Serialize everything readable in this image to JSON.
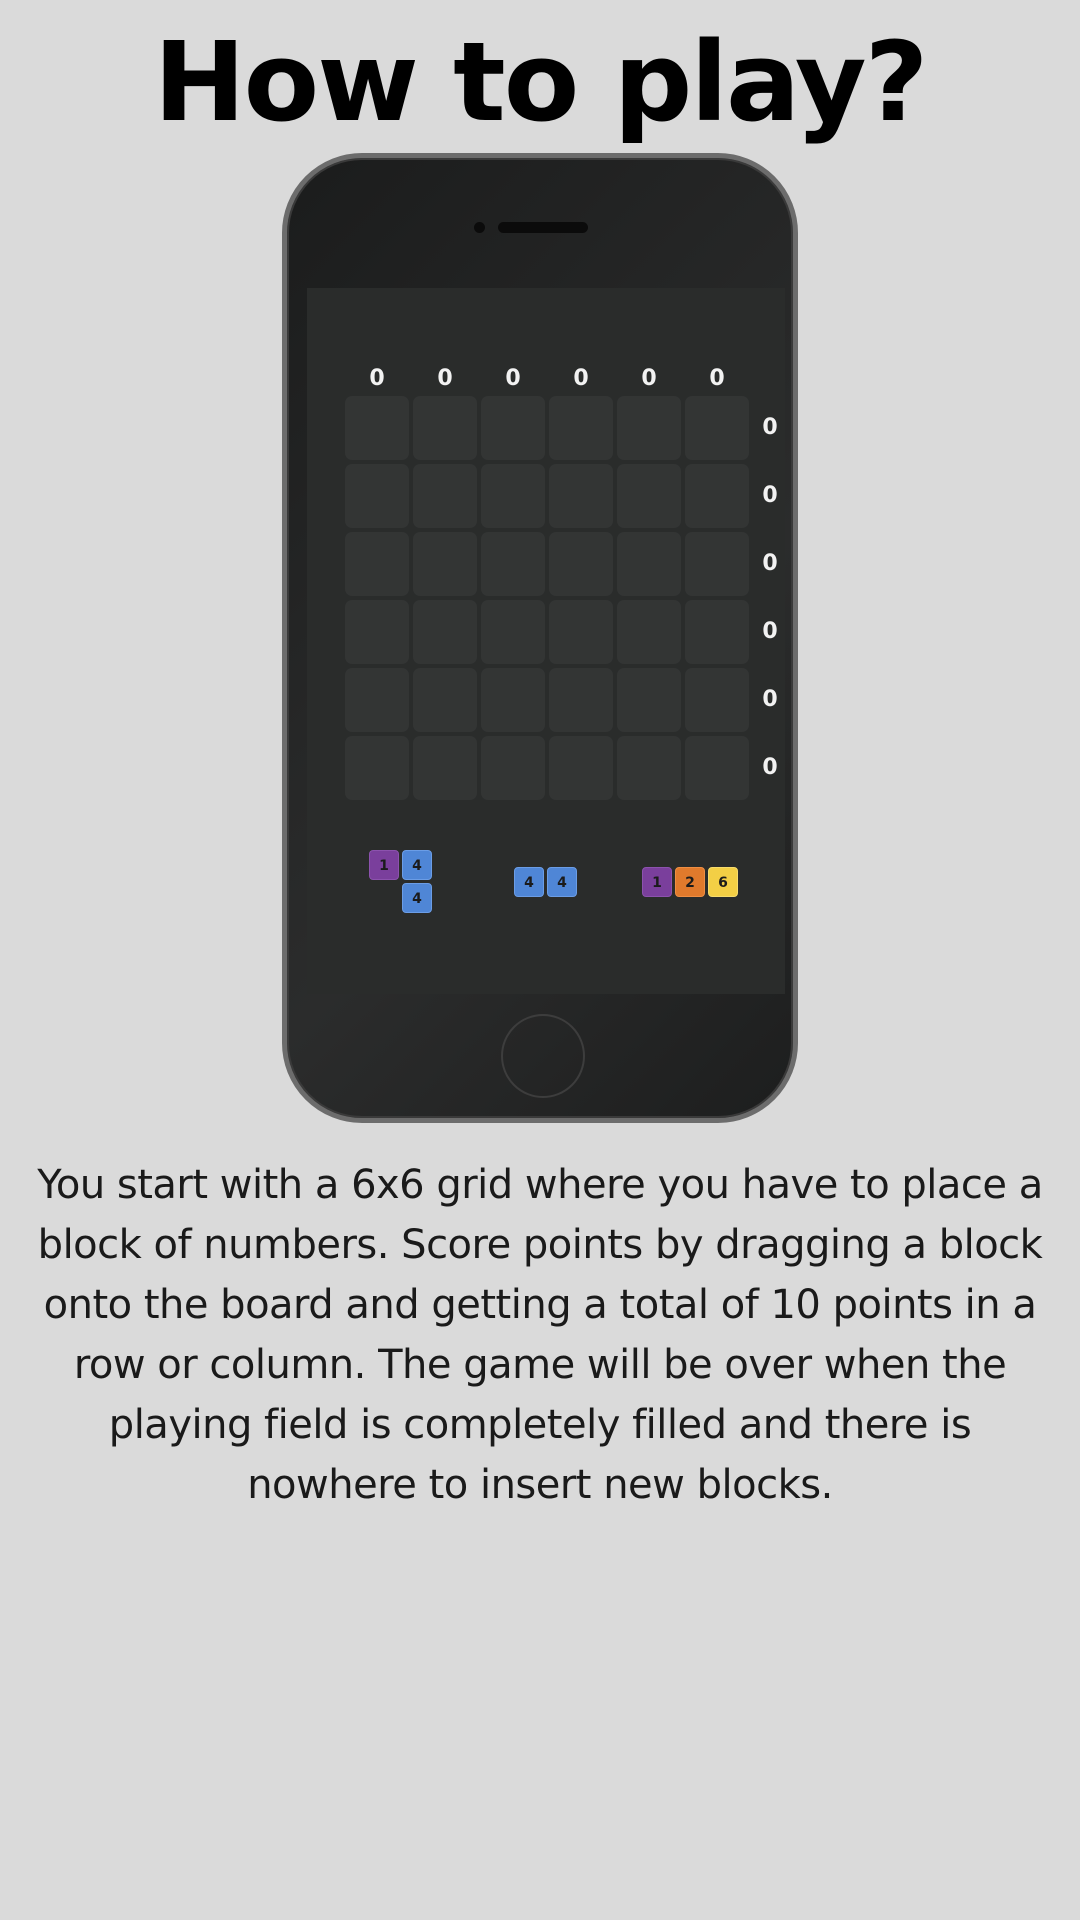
{
  "title": "How to play?",
  "column_scores": [
    "0",
    "0",
    "0",
    "0",
    "0",
    "0"
  ],
  "row_scores": [
    "0",
    "0",
    "0",
    "0",
    "0",
    "0"
  ],
  "pieces": [
    {
      "name": "piece-1",
      "tiles": [
        {
          "value": "1",
          "color": "purple",
          "col": 0,
          "row": 0
        },
        {
          "value": "4",
          "color": "blue",
          "col": 1,
          "row": 0
        },
        {
          "value": "4",
          "color": "blue",
          "col": 1,
          "row": 1
        }
      ]
    },
    {
      "name": "piece-2",
      "tiles": [
        {
          "value": "4",
          "color": "blue",
          "col": 0,
          "row": 0
        },
        {
          "value": "4",
          "color": "blue",
          "col": 1,
          "row": 0
        }
      ]
    },
    {
      "name": "piece-3",
      "tiles": [
        {
          "value": "1",
          "color": "purple",
          "col": 0,
          "row": 0
        },
        {
          "value": "2",
          "color": "orange",
          "col": 1,
          "row": 0
        },
        {
          "value": "6",
          "color": "yellow",
          "col": 2,
          "row": 0
        }
      ]
    }
  ],
  "colors": {
    "background": "#dadada",
    "blue": "#4f86d6",
    "purple": "#7a3f9c",
    "orange": "#e07a2c",
    "yellow": "#f3cf45"
  },
  "description": "You start with a 6x6 grid where you have to place a block of numbers. Score points by dragging a block onto the board and getting a total of 10 points in a row or column. The game will be over when the playing field is completely filled and there is nowhere to insert new blocks."
}
